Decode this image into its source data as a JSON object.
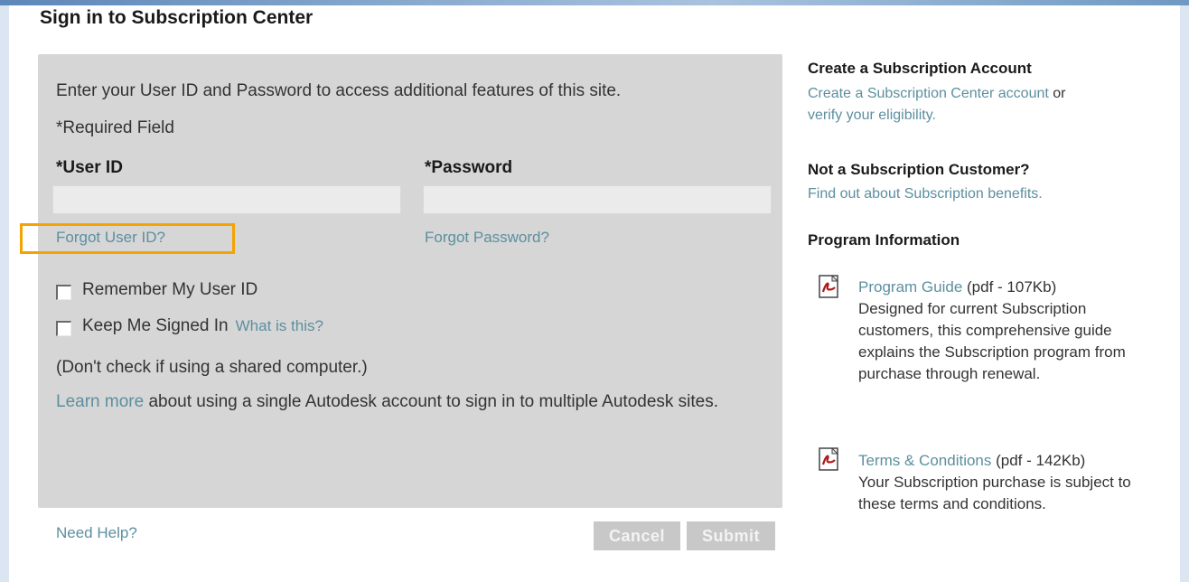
{
  "page_title": "Sign in to Subscription Center",
  "login": {
    "intro": "Enter your User ID and Password to access additional features of this site.",
    "required_note": "*Required Field",
    "user_id_label": "*User ID",
    "password_label": "*Password",
    "user_id_value": "",
    "password_value": "",
    "forgot_user_id": "Forgot User ID?",
    "forgot_password": "Forgot Password?",
    "remember_label": "Remember My User ID",
    "remember_checked": false,
    "keep_signed_label": "Keep Me Signed In",
    "keep_signed_checked": false,
    "whats_this": "What is this?",
    "shared_note": "(Don't check if using a shared computer.)",
    "learn_more_link": "Learn more",
    "learn_more_text": " about using a single Autodesk account to sign in to multiple Autodesk sites.",
    "need_help": "Need Help?",
    "cancel_label": "Cancel",
    "submit_label": "Submit"
  },
  "sidebar": {
    "create_title": "Create a Subscription Account",
    "create_link": "Create a Subscription Center account",
    "create_or": " or",
    "verify_link": "verify your eligibility.",
    "not_customer_title": "Not a Subscription Customer?",
    "find_out_link": "Find out about Subscription benefits.",
    "program_info_title": "Program Information",
    "docs": [
      {
        "link": "Program Guide",
        "meta": " (pdf - 107Kb)",
        "description": "Designed for current Subscription customers, this comprehensive guide explains the Subscription program from purchase through renewal.",
        "icon": "pdf-icon"
      },
      {
        "link": "Terms & Conditions",
        "meta": " (pdf - 142Kb)",
        "description": "Your Subscription purchase is subject to these terms and conditions.",
        "icon": "pdf-icon"
      }
    ]
  },
  "colors": {
    "link": "#5c8fa0",
    "highlight": "#f5a300",
    "panel": "#d6d6d6"
  }
}
